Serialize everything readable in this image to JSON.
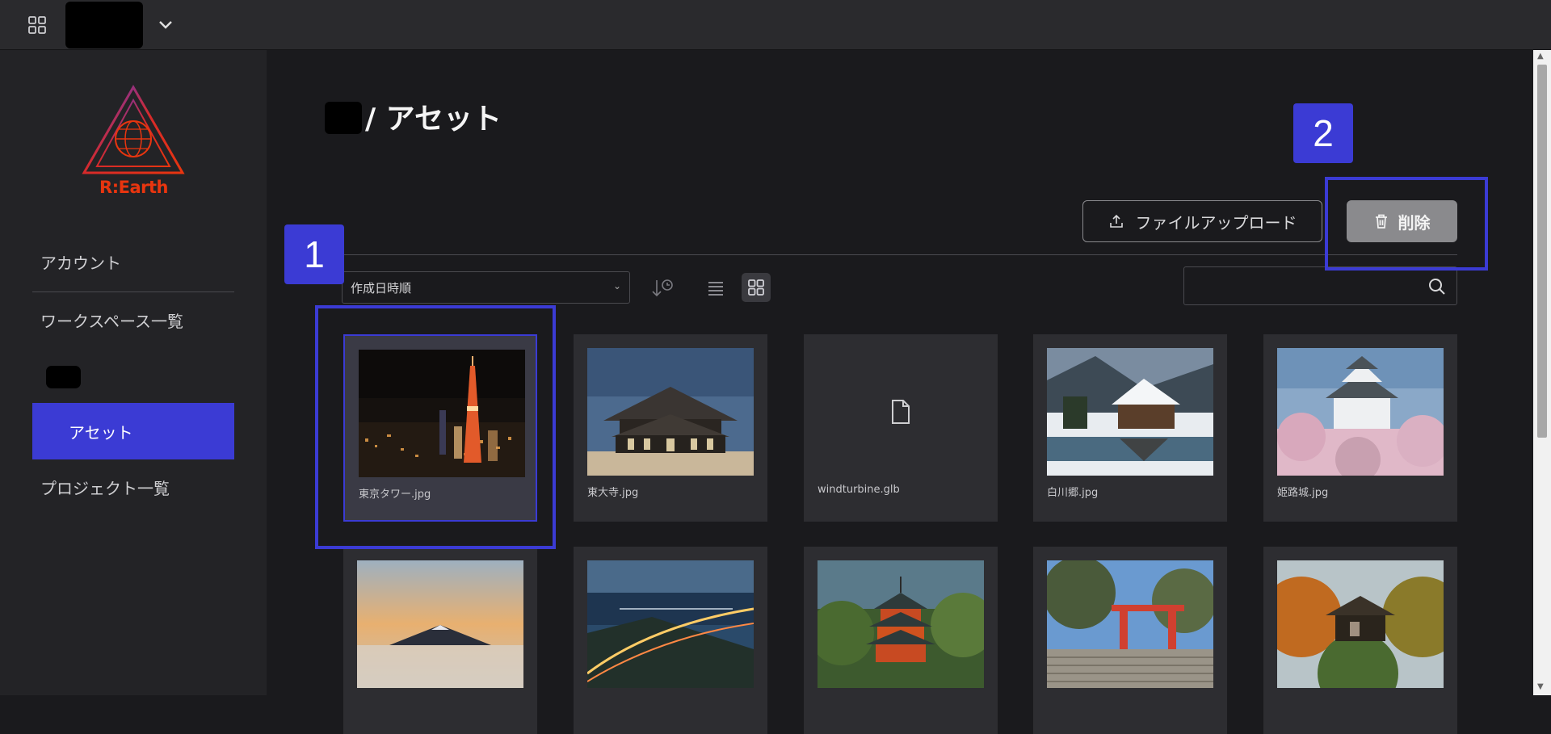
{
  "sidebar": {
    "logo_text": "R:Earth",
    "items": [
      {
        "label": "アカウント"
      },
      {
        "label": "ワークスペース一覧"
      },
      {
        "label": "アセット"
      },
      {
        "label": "プロジェクト一覧"
      }
    ]
  },
  "header": {
    "title": "/ アセット"
  },
  "toolbar": {
    "upload_label": "ファイルアップロード",
    "delete_label": "削除",
    "sort_value": "作成日時順"
  },
  "search": {
    "value": ""
  },
  "annotations": {
    "badge1": "1",
    "badge2": "2"
  },
  "assets": [
    {
      "name": "東京タワー.jpg",
      "thumb": "tokyo-tower",
      "selected": true
    },
    {
      "name": "東大寺.jpg",
      "thumb": "todaiji"
    },
    {
      "name": "windturbine.glb",
      "thumb": "file-icon"
    },
    {
      "name": "白川郷.jpg",
      "thumb": "shirakawago"
    },
    {
      "name": "姫路城.jpg",
      "thumb": "himeji"
    },
    {
      "name": "",
      "thumb": "fuji"
    },
    {
      "name": "",
      "thumb": "bridge"
    },
    {
      "name": "",
      "thumb": "pagoda"
    },
    {
      "name": "",
      "thumb": "shrine"
    },
    {
      "name": "",
      "thumb": "garden"
    }
  ],
  "colors": {
    "accent": "#3b3bd4",
    "logo": "#e8350f"
  }
}
